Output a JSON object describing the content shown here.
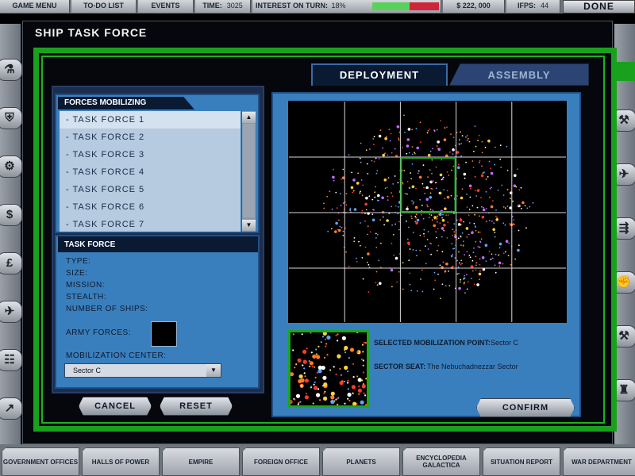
{
  "topbar": {
    "game_menu": "GAME MENU",
    "todo": "TO-DO LIST",
    "events": "EVENTS",
    "time_label": "TIME:",
    "time_value": "3025",
    "interest_label": "INTEREST ON TURN:",
    "interest_value": "18%",
    "interest_fraction": 0.56,
    "money": "$ 222, 000",
    "ifps_label": "IFPs:",
    "ifps_value": "44",
    "done": "DONE",
    "bar_green": "#59d25a",
    "bar_red": "#d0243a"
  },
  "title": "SHIP TASK FORCE",
  "tabs": {
    "deployment": "DEPLOYMENT",
    "assembly": "ASSEMBLY"
  },
  "forces": {
    "header": "FORCES MOBILIZING",
    "items": [
      "- TASK FORCE 1",
      "- TASK FORCE 2",
      "- TASK FORCE 3",
      "- TASK FORCE 4",
      "- TASK FORCE 5",
      "- TASK FORCE 6",
      "- TASK FORCE 7"
    ],
    "selected_index": 0
  },
  "task_force": {
    "header": "TASK FORCE",
    "type": "TYPE:",
    "size": "SIZE:",
    "mission": "MISSION:",
    "stealth": "STEALTH:",
    "ships": "NUMBER OF SHIPS:",
    "army": "ARMY FORCES:",
    "mob_center_label": "MOBILIZATION CENTER:",
    "mob_center_value": "Sector C"
  },
  "buttons": {
    "cancel": "CANCEL",
    "reset": "RESET",
    "confirm": "CONFIRM"
  },
  "info": {
    "mob_point_label": "SELECTED MOBILIZATION POINT:",
    "mob_point_value": "Sector C",
    "seat_label": "SECTOR SEAT:",
    "seat_value": "The Nebuchadnezzar Sector"
  },
  "map": {
    "cols": 5,
    "rows": 4,
    "selected_col": 2,
    "selected_row": 1,
    "highlight": "#1bb31f"
  },
  "bottom_nav": [
    "GOVERNMENT OFFICES",
    "HALLS OF POWER",
    "EMPIRE",
    "FOREIGN OFFICE",
    "PLANETS",
    "ENCYCLOPEDIA GALACTICA",
    "SITUATION REPORT",
    "WAR DEPARTMENT"
  ],
  "left_icons": [
    "flask-icon",
    "shield-icon",
    "cog-icon",
    "dollar-icon",
    "pound-icon",
    "ships-icon",
    "hierarchy-icon",
    "chart-icon"
  ],
  "right_icons": [
    "wrench-icon",
    "fighter-icon",
    "fleet-icon",
    "fist-icon",
    "hammer-icon",
    "cup-icon"
  ]
}
